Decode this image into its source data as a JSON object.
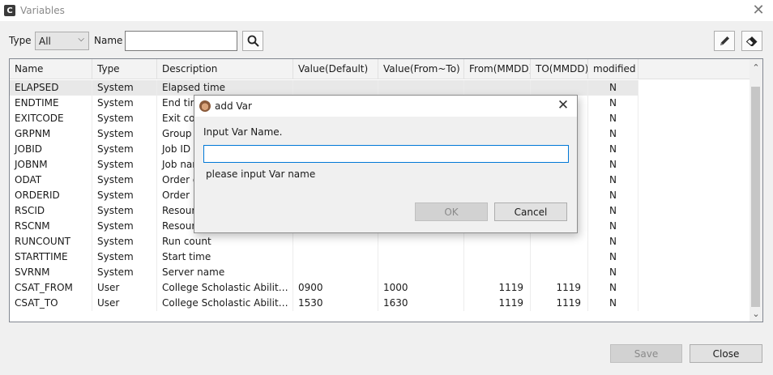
{
  "window": {
    "title": "Variables"
  },
  "filter": {
    "type_label": "Type",
    "type_value": "All",
    "name_label": "Name",
    "name_value": "",
    "search_icon": "search-icon",
    "edit_icon": "pencil-icon",
    "clear_icon": "eraser-icon"
  },
  "table": {
    "columns": [
      "Name",
      "Type",
      "Description",
      "Value(Default)",
      "Value(From~To)",
      "From(MMDD)",
      "TO(MMDD)",
      "modified"
    ],
    "rows": [
      [
        "ELAPSED",
        "System",
        "Elapsed time",
        "",
        "",
        "",
        "",
        "N"
      ],
      [
        "ENDTIME",
        "System",
        "End time",
        "",
        "",
        "",
        "",
        "N"
      ],
      [
        "EXITCODE",
        "System",
        "Exit code",
        "",
        "",
        "",
        "",
        "N"
      ],
      [
        "GRPNM",
        "System",
        "Group name",
        "",
        "",
        "",
        "",
        "N"
      ],
      [
        "JOBID",
        "System",
        "Job ID",
        "",
        "",
        "",
        "",
        "N"
      ],
      [
        "JOBNM",
        "System",
        "Job name",
        "",
        "",
        "",
        "",
        "N"
      ],
      [
        "ODAT",
        "System",
        "Order date",
        "",
        "",
        "",
        "",
        "N"
      ],
      [
        "ORDERID",
        "System",
        "Order ID",
        "",
        "",
        "",
        "",
        "N"
      ],
      [
        "RSCID",
        "System",
        "Resource ID",
        "",
        "",
        "",
        "",
        "N"
      ],
      [
        "RSCNM",
        "System",
        "Resource name",
        "",
        "",
        "",
        "",
        "N"
      ],
      [
        "RUNCOUNT",
        "System",
        "Run count",
        "",
        "",
        "",
        "",
        "N"
      ],
      [
        "STARTTIME",
        "System",
        "Start time",
        "",
        "",
        "",
        "",
        "N"
      ],
      [
        "SVRNM",
        "System",
        "Server name",
        "",
        "",
        "",
        "",
        "N"
      ],
      [
        "CSAT_FROM",
        "User",
        "College Scholastic Ability Test",
        "0900",
        "1000",
        "1119",
        "1119",
        "N"
      ],
      [
        "CSAT_TO",
        "User",
        "College Scholastic Ability Test",
        "1530",
        "1630",
        "1119",
        "1119",
        "N"
      ]
    ]
  },
  "footer": {
    "save_label": "Save",
    "close_label": "Close"
  },
  "dialog": {
    "title": "add Var",
    "prompt": "Input Var Name.",
    "input_value": "",
    "hint": "please input Var name",
    "ok_label": "OK",
    "cancel_label": "Cancel"
  }
}
